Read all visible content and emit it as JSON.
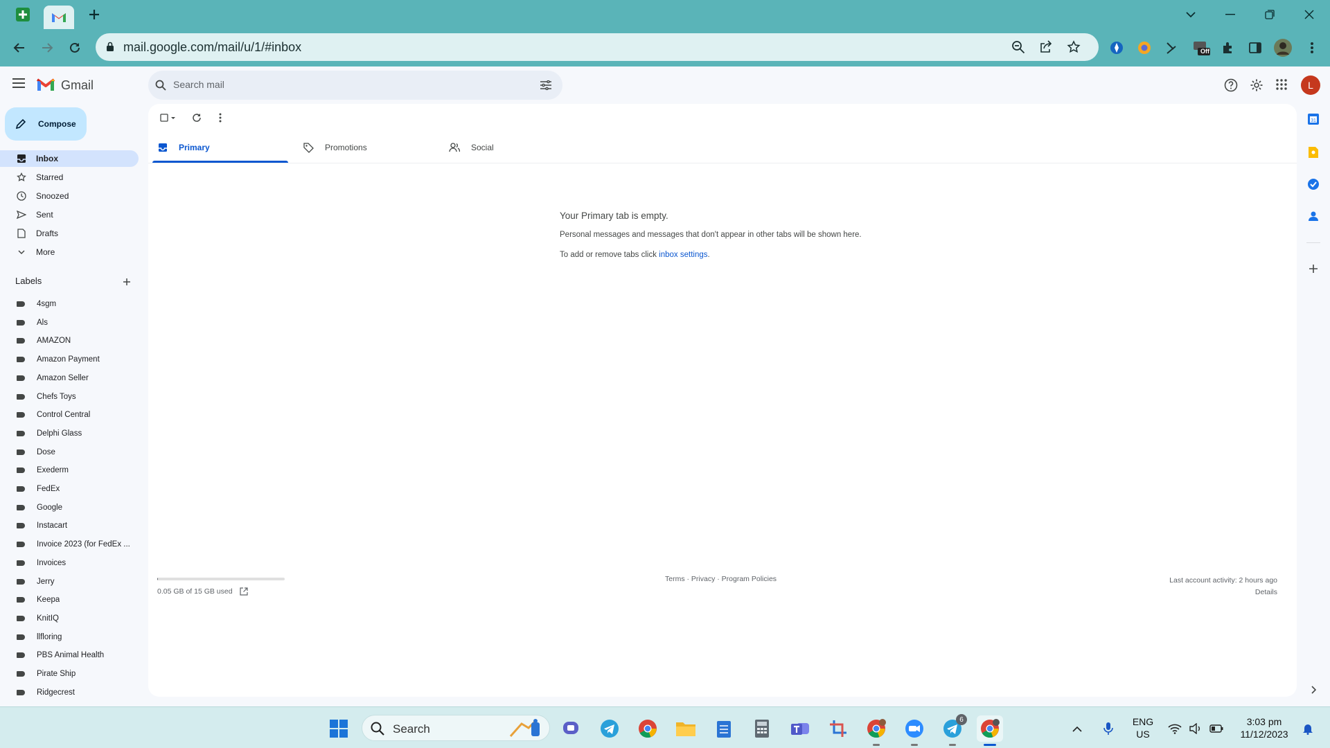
{
  "browser": {
    "url": "mail.google.com/mail/u/1/#inbox",
    "extension_badge": "Off"
  },
  "gmail": {
    "app_name": "Gmail",
    "search_placeholder": "Search mail",
    "avatar_letter": "L",
    "compose_label": "Compose",
    "nav": [
      {
        "label": "Inbox",
        "icon": "inbox-icon",
        "active": true
      },
      {
        "label": "Starred",
        "icon": "star-icon"
      },
      {
        "label": "Snoozed",
        "icon": "clock-icon"
      },
      {
        "label": "Sent",
        "icon": "send-icon"
      },
      {
        "label": "Drafts",
        "icon": "draft-icon"
      },
      {
        "label": "More",
        "icon": "chevron-down-icon"
      }
    ],
    "labels_header": "Labels",
    "labels": [
      "4sgm",
      "Als",
      "AMAZON",
      "Amazon Payment",
      "Amazon Seller",
      "Chefs Toys",
      "Control Central",
      "Delphi Glass",
      "Dose",
      "Exederm",
      "FedEx",
      "Google",
      "Instacart",
      "Invoice 2023 (for FedEx ...",
      "Invoices",
      "Jerry",
      "Keepa",
      "KnitIQ",
      "llfloring",
      "PBS Animal Health",
      "Pirate Ship",
      "Ridgecrest"
    ],
    "tabs": [
      {
        "label": "Primary",
        "icon": "inbox-tab-icon",
        "active": true
      },
      {
        "label": "Promotions",
        "icon": "tag-icon"
      },
      {
        "label": "Social",
        "icon": "people-icon"
      }
    ],
    "empty": {
      "title": "Your Primary tab is empty.",
      "line1": "Personal messages and messages that don't appear in other tabs will be shown here.",
      "line2_prefix": "To add or remove tabs click ",
      "line2_link": "inbox settings",
      "line2_suffix": "."
    },
    "storage": {
      "text": "0.05 GB of 15 GB used",
      "fraction": 0.0033
    },
    "footer_links": "Terms · Privacy · Program Policies",
    "activity": {
      "line1": "Last account activity: 2 hours ago",
      "line2": "Details"
    }
  },
  "taskbar": {
    "search_label": "Search",
    "lang_line1": "ENG",
    "lang_line2": "US",
    "time": "3:03 pm",
    "date": "11/12/2023",
    "telegram_badge": "6"
  },
  "colors": {
    "browser_frame": "#5ab4b8",
    "gmail_bg": "#f6f8fc",
    "compose": "#c2e7ff",
    "active_nav": "#d3e3fd",
    "accent_blue": "#0b57d0",
    "avatar": "#c5381d"
  }
}
